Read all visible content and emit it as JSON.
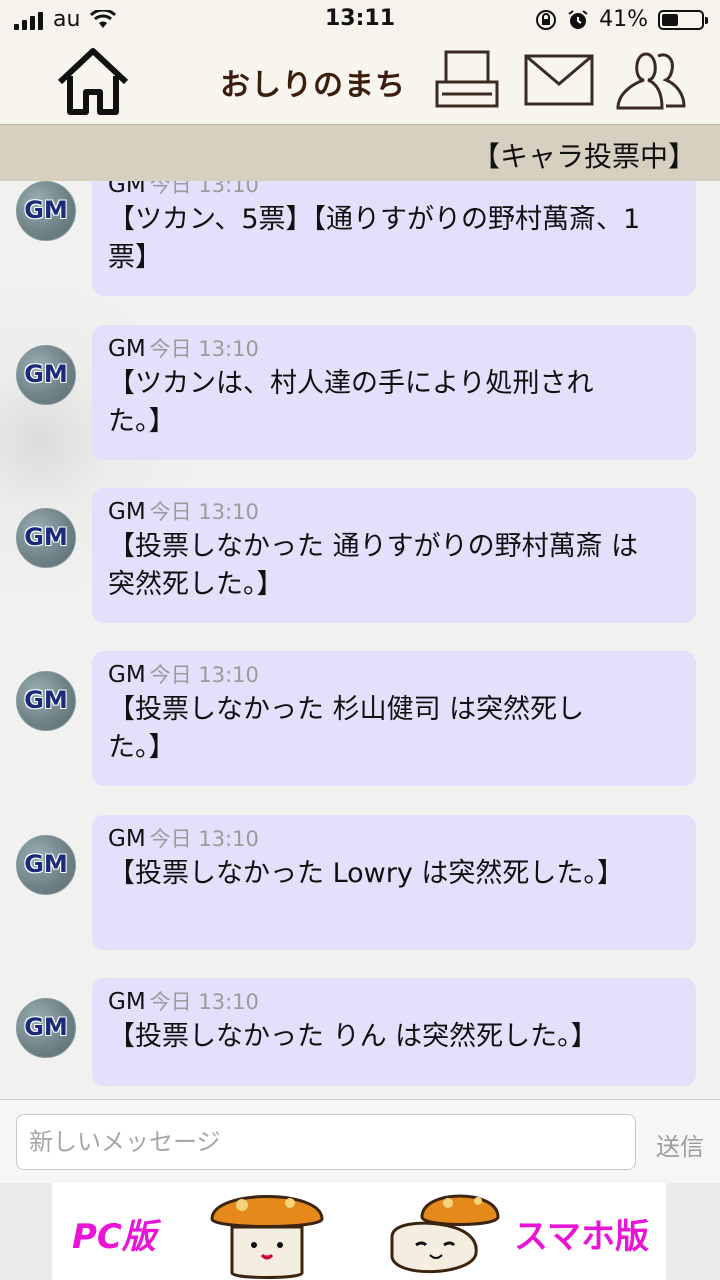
{
  "status_bar": {
    "carrier": "au",
    "time": "13:11",
    "battery": "41%",
    "battery_level": 0.41
  },
  "header": {
    "title": "おしりのまち",
    "icons": [
      "home-icon",
      "printer-icon",
      "mail-icon",
      "users-icon"
    ]
  },
  "banner": {
    "text": "【キャラ投票中】"
  },
  "messages": [
    {
      "name": "GM",
      "time": "今日 13:10",
      "avatar": "GM",
      "text_lines": [
        "【ツカン、5票】【通りすがりの野村萬斎、1",
        "票】"
      ]
    },
    {
      "name": "GM",
      "time": "今日 13:10",
      "avatar": "GM",
      "text_lines": [
        "【ツカンは、村人達の手により処刑され",
        "た。】"
      ]
    },
    {
      "name": "GM",
      "time": "今日 13:10",
      "avatar": "GM",
      "text_lines": [
        "【投票しなかった 通りすがりの野村萬斎 は",
        "突然死した。】"
      ]
    },
    {
      "name": "GM",
      "time": "今日 13:10",
      "avatar": "GM",
      "text_lines": [
        "【投票しなかった 杉山健司 は突然死し",
        "た。】"
      ]
    },
    {
      "name": "GM",
      "time": "今日 13:10",
      "avatar": "GM",
      "text_lines": [
        "【投票しなかった Lowry は突然死した。】",
        ""
      ]
    },
    {
      "name": "GM",
      "time": "今日 13:10",
      "avatar": "GM",
      "text_lines": [
        "【投票しなかった りん は突然死した。】",
        ""
      ]
    }
  ],
  "composer": {
    "placeholder": "新しいメッセージ",
    "send_label": "送信"
  },
  "ad": {
    "left_label": "PC版",
    "right_label": "スマホ版"
  },
  "colors": {
    "bubble": "#e2e0fb",
    "header_title": "#3b1e0e",
    "banner": "#d7d0c0",
    "ad_text": "#e815d6"
  }
}
